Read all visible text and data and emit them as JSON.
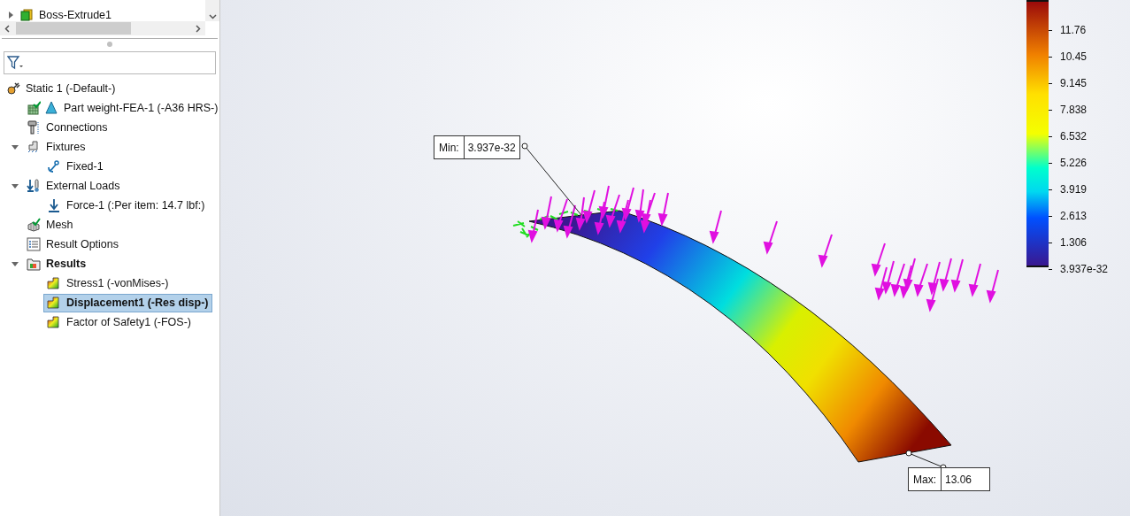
{
  "feature_tree": {
    "items": [
      {
        "label": "Boss-Extrude1",
        "kind": "part",
        "expanded": false
      }
    ]
  },
  "study_tree": {
    "items": [
      {
        "label": "Static 1 (-Default-)",
        "kind": "study",
        "selected": false,
        "bold": false,
        "children": [
          {
            "label": "Part weight-FEA-1 (-A36 HRS-)",
            "kind": "part-mesh",
            "selected": false,
            "bold": false
          },
          {
            "label": "Connections",
            "kind": "connections",
            "selected": false,
            "bold": false
          },
          {
            "label": "Fixtures",
            "kind": "fixtures",
            "selected": false,
            "bold": false,
            "expanded": true,
            "children": [
              {
                "label": "Fixed-1",
                "kind": "fixed",
                "selected": false,
                "bold": false
              }
            ]
          },
          {
            "label": "External Loads",
            "kind": "loads",
            "selected": false,
            "bold": false,
            "expanded": true,
            "children": [
              {
                "label": "Force-1 (:Per item: 14.7 lbf:)",
                "kind": "force",
                "selected": false,
                "bold": false
              }
            ]
          },
          {
            "label": "Mesh",
            "kind": "mesh",
            "selected": false,
            "bold": false
          },
          {
            "label": "Result Options",
            "kind": "options",
            "selected": false,
            "bold": false
          },
          {
            "label": "Results",
            "kind": "folder",
            "selected": false,
            "bold": true,
            "expanded": true,
            "children": [
              {
                "label": "Stress1 (-vonMises-)",
                "kind": "plot",
                "selected": false,
                "bold": false
              },
              {
                "label": "Displacement1 (-Res disp-)",
                "kind": "plot",
                "selected": true,
                "bold": true
              },
              {
                "label": "Factor of Safety1 (-FOS-)",
                "kind": "plot",
                "selected": false,
                "bold": false
              }
            ]
          }
        ]
      }
    ]
  },
  "viewport": {
    "min_probe": {
      "label": "Min:",
      "value": "3.937e-32"
    },
    "max_probe": {
      "label": "Max:",
      "value": "13.06"
    },
    "legend": {
      "labels": [
        "11.76",
        "10.45",
        "9.145",
        "7.838",
        "6.532",
        "5.226",
        "3.919",
        "2.613",
        "1.306",
        "3.937e-32"
      ]
    }
  }
}
